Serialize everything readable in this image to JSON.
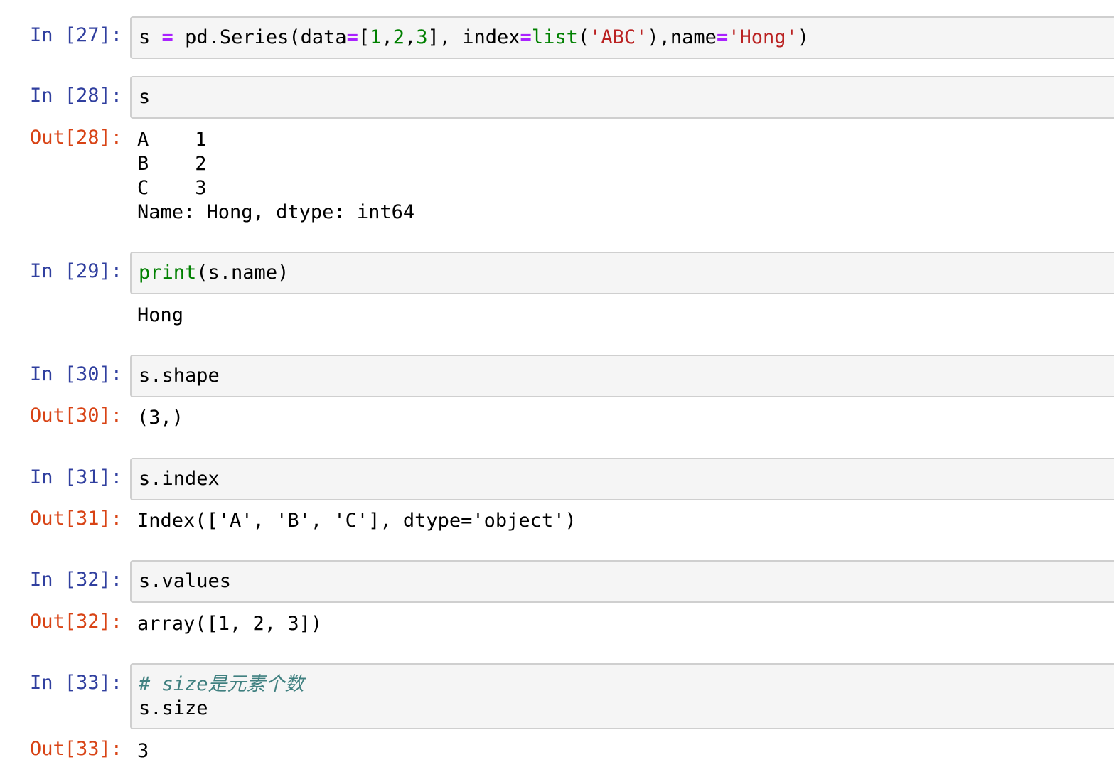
{
  "cells": [
    {
      "in_prompt": "In [27]:",
      "code": {
        "var": "s",
        "eq": "=",
        "call_start": "pd.Series(data",
        "eq2": "=",
        "bracket_open": "[",
        "n1": "1",
        "comma1": ",",
        "n2": "2",
        "comma2": ",",
        "n3": "3",
        "bracket_close": "], index",
        "eq3": "=",
        "list_fn": "list",
        "paren_open": "(",
        "abc": "'ABC'",
        "mid": "),name",
        "eq4": "=",
        "hong": "'Hong'",
        "paren_close": ")"
      }
    },
    {
      "in_prompt": "In [28]:",
      "code": "s",
      "out_prompt": "Out[28]:",
      "output": [
        "A    1",
        "B    2",
        "C    3",
        "Name: Hong, dtype: int64"
      ]
    },
    {
      "in_prompt": "In [29]:",
      "code": {
        "fn": "print",
        "rest": "(s.name)"
      },
      "stdout": "Hong"
    },
    {
      "in_prompt": "In [30]:",
      "code": "s.shape",
      "out_prompt": "Out[30]:",
      "output": "(3,)"
    },
    {
      "in_prompt": "In [31]:",
      "code": "s.index",
      "out_prompt": "Out[31]:",
      "output": "Index(['A', 'B', 'C'], dtype='object')"
    },
    {
      "in_prompt": "In [32]:",
      "code": "s.values",
      "out_prompt": "Out[32]:",
      "output": "array([1, 2, 3])"
    },
    {
      "in_prompt": "In [33]:",
      "code": {
        "comment": "# size是元素个数",
        "line2": "s.size"
      },
      "out_prompt": "Out[33]:",
      "output": "3"
    }
  ]
}
